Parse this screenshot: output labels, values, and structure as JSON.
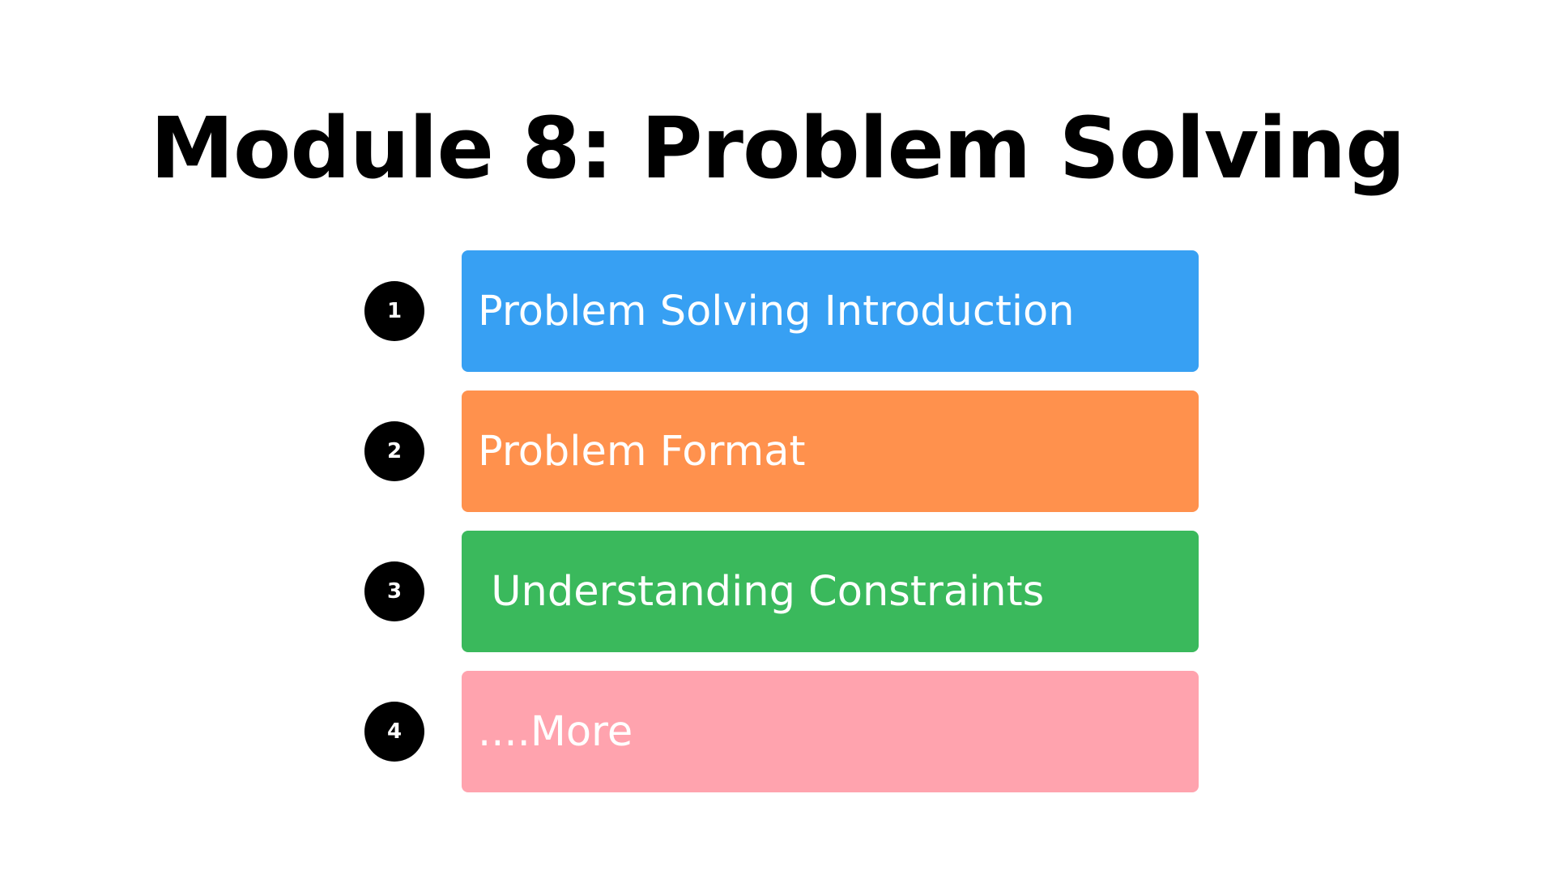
{
  "slide": {
    "title": "Module 8: Problem Solving",
    "items": [
      {
        "number": "1",
        "label": "Problem Solving Introduction",
        "color": "#37a0f3"
      },
      {
        "number": "2",
        "label": "Problem Format",
        "color": "#ff914d"
      },
      {
        "number": "3",
        "label": " Understanding Constraints",
        "color": "#3ab95c"
      },
      {
        "number": "4",
        "label": "....More",
        "color": "#ffa3ae"
      }
    ]
  }
}
